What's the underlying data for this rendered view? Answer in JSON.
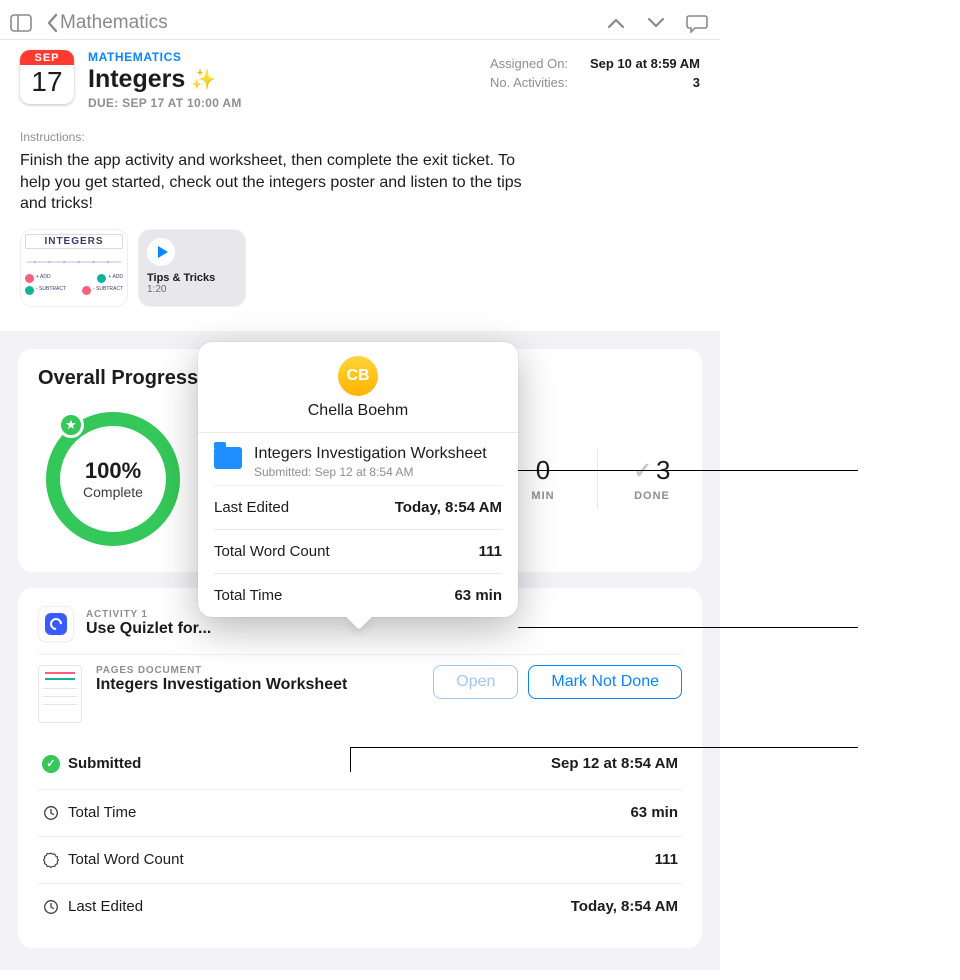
{
  "nav": {
    "back_label": "Mathematics"
  },
  "header": {
    "cal_month": "SEP",
    "cal_day": "17",
    "subject": "MATHEMATICS",
    "title": "Integers",
    "due": "DUE: SEP 17 AT 10:00 AM",
    "assigned_label": "Assigned On:",
    "assigned_value": "Sep 10 at 8:59 AM",
    "activities_label": "No. Activities:",
    "activities_value": "3"
  },
  "instructions": {
    "label": "Instructions:",
    "text": "Finish the app activity and worksheet, then complete the exit ticket. To help you get started, check out the integers poster and listen to the tips and tricks!"
  },
  "attachments": {
    "poster_title": "INTEGERS",
    "video_title": "Tips & Tricks",
    "video_duration": "1:20"
  },
  "progress": {
    "heading": "Overall Progress",
    "percent_text": "100%",
    "complete_text": "Complete",
    "stats": {
      "min_value": "0",
      "min_label": "MIN",
      "done_value": "3",
      "done_label": "DONE"
    }
  },
  "activity": {
    "index_label": "ACTIVITY 1",
    "title": "Use Quizlet for...",
    "doc_kind": "PAGES DOCUMENT",
    "doc_title": "Integers Investigation Worksheet",
    "open_label": "Open",
    "markdone_label": "Mark Not Done",
    "rows": {
      "submitted_label": "Submitted",
      "submitted_value": "Sep 12 at 8:54 AM",
      "time_label": "Total Time",
      "time_value": "63 min",
      "words_label": "Total Word Count",
      "words_value": "111",
      "edited_label": "Last Edited",
      "edited_value": "Today, 8:54 AM"
    }
  },
  "popover": {
    "initials": "CB",
    "student": "Chella Boehm",
    "doc_title": "Integers Investigation Worksheet",
    "doc_sub": "Submitted: Sep 12 at 8:54 AM",
    "rows": {
      "edited_label": "Last Edited",
      "edited_value": "Today, 8:54 AM",
      "words_label": "Total Word Count",
      "words_value": "111",
      "time_label": "Total Time",
      "time_value": "63 min"
    }
  }
}
